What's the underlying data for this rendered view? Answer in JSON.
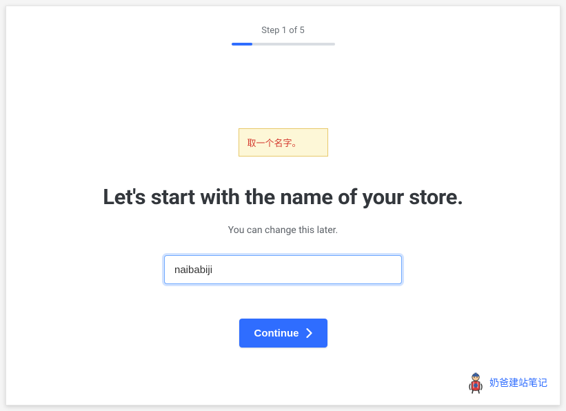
{
  "progress": {
    "label": "Step 1 of 5",
    "percent": 20
  },
  "callout": {
    "text": "取一个名字。"
  },
  "heading": "Let's start with the name of your store.",
  "subheading": "You can change this later.",
  "input": {
    "value": "naibabiji",
    "placeholder": ""
  },
  "continue": {
    "label": "Continue"
  },
  "watermark": {
    "text": "奶爸建站笔记"
  },
  "colors": {
    "accent": "#2f6dff",
    "callout_bg": "#fdf7d7",
    "callout_border": "#e7c96b",
    "callout_text": "#d43a2f"
  }
}
